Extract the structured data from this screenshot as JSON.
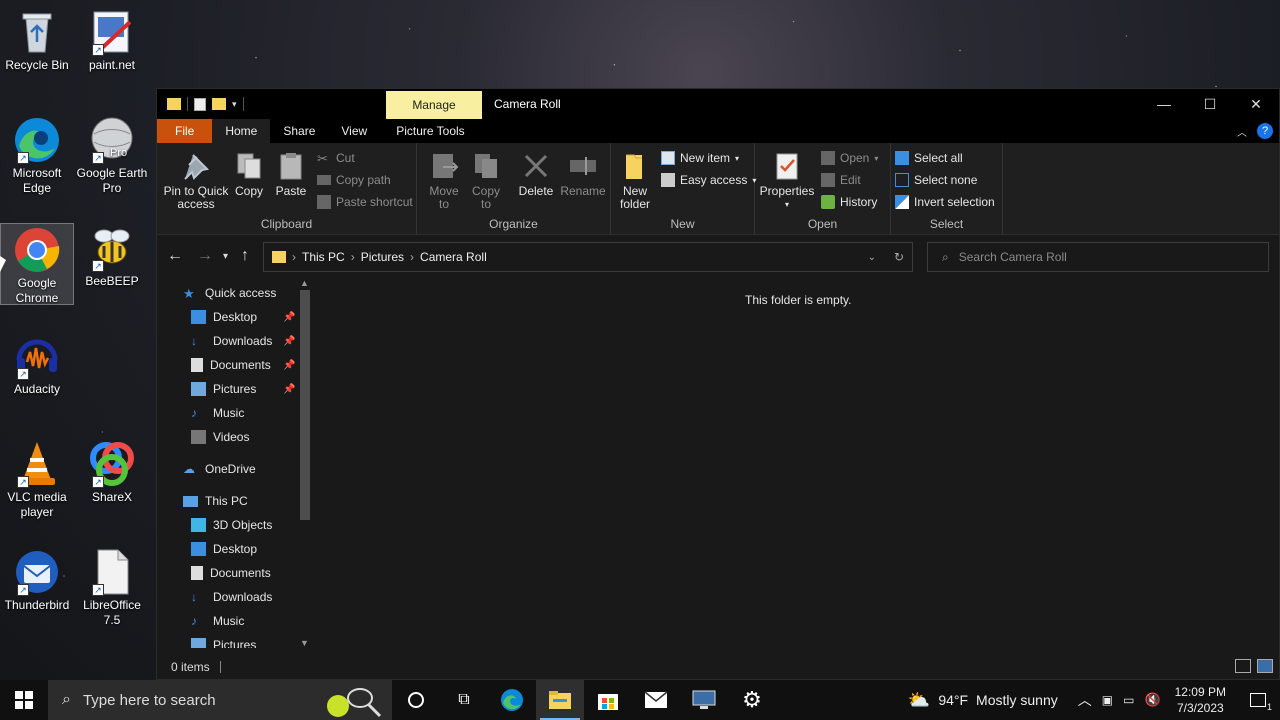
{
  "desktop": {
    "icons": [
      {
        "label": "Recycle Bin"
      },
      {
        "label": "paint.net"
      },
      {
        "label": "Microsoft Edge"
      },
      {
        "label": "Google Earth Pro"
      },
      {
        "label": "Google Chrome"
      },
      {
        "label": "BeeBEEP"
      },
      {
        "label": "Audacity"
      },
      {
        "label": "VLC media player"
      },
      {
        "label": "ShareX"
      },
      {
        "label": "Thunderbird"
      },
      {
        "label": "LibreOffice 7.5"
      }
    ],
    "earth_badge": "Pro"
  },
  "window": {
    "contextual_tab": "Manage",
    "title": "Camera Roll",
    "tabs": [
      "File",
      "Home",
      "Share",
      "View",
      "Picture Tools"
    ],
    "ribbon": {
      "clipboard": {
        "label": "Clipboard",
        "pin": "Pin to Quick access",
        "copy": "Copy",
        "paste": "Paste",
        "cut": "Cut",
        "copy_path": "Copy path",
        "paste_shortcut": "Paste shortcut"
      },
      "organize": {
        "label": "Organize",
        "move_to": "Move to",
        "copy_to": "Copy to",
        "delete": "Delete",
        "rename": "Rename"
      },
      "new": {
        "label": "New",
        "new_folder": "New folder",
        "new_item": "New item",
        "easy_access": "Easy access"
      },
      "open": {
        "label": "Open",
        "properties": "Properties",
        "open": "Open",
        "edit": "Edit",
        "history": "History"
      },
      "select": {
        "label": "Select",
        "select_all": "Select all",
        "select_none": "Select none",
        "invert": "Invert selection"
      }
    },
    "address": {
      "crumbs": [
        "This PC",
        "Pictures",
        "Camera Roll"
      ]
    },
    "search": {
      "placeholder": "Search Camera Roll"
    },
    "nav": {
      "quick_access": "Quick access",
      "qa_items": [
        "Desktop",
        "Downloads",
        "Documents",
        "Pictures",
        "Music",
        "Videos"
      ],
      "onedrive": "OneDrive",
      "this_pc": "This PC",
      "pc_items": [
        "3D Objects",
        "Desktop",
        "Documents",
        "Downloads",
        "Music",
        "Pictures"
      ]
    },
    "content": {
      "empty_message": "This folder is empty."
    },
    "status": {
      "items": "0 items"
    }
  },
  "taskbar": {
    "search_placeholder": "Type here to search",
    "weather": {
      "temp": "94°F",
      "condition": "Mostly sunny"
    },
    "time": "12:09 PM",
    "date": "7/3/2023",
    "notification_count": "1"
  },
  "colors": {
    "file_tab": "#c9510c",
    "manage_tab": "#f8f0a0",
    "accent": "#76b9ed",
    "folder": "#f6d35e"
  }
}
